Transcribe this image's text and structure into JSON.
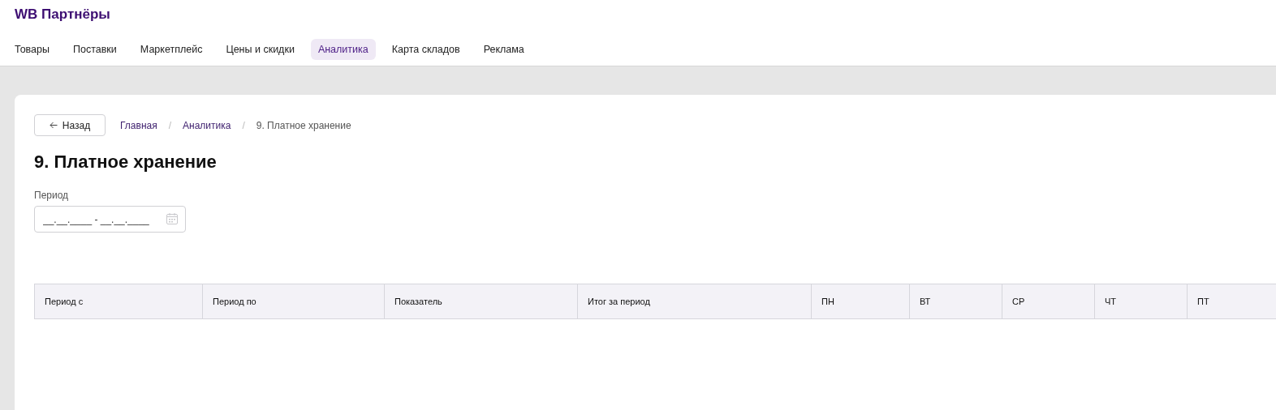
{
  "logo": "WB Партнёры",
  "nav": [
    {
      "label": "Товары",
      "selected": false
    },
    {
      "label": "Поставки",
      "selected": false
    },
    {
      "label": "Маркетплейс",
      "selected": false
    },
    {
      "label": "Цены и скидки",
      "selected": false
    },
    {
      "label": "Аналитика",
      "selected": true
    },
    {
      "label": "Карта складов",
      "selected": false
    },
    {
      "label": "Реклама",
      "selected": false
    }
  ],
  "back_button": {
    "label": "Назад"
  },
  "breadcrumbs": [
    {
      "label": "Главная",
      "kind": "link"
    },
    {
      "label": "Аналитика",
      "kind": "link"
    },
    {
      "label": "9. Платное хранение",
      "kind": "current"
    }
  ],
  "breadcrumb_separator": "/",
  "heading": "9. Платное хранение",
  "period_field": {
    "label": "Период",
    "placeholder": "__.__.____ - __.__.____"
  },
  "table": {
    "columns": [
      "Период с",
      "Период по",
      "Показатель",
      "Итог за период",
      "ПН",
      "ВТ",
      "СР",
      "ЧТ",
      "ПТ"
    ]
  }
}
